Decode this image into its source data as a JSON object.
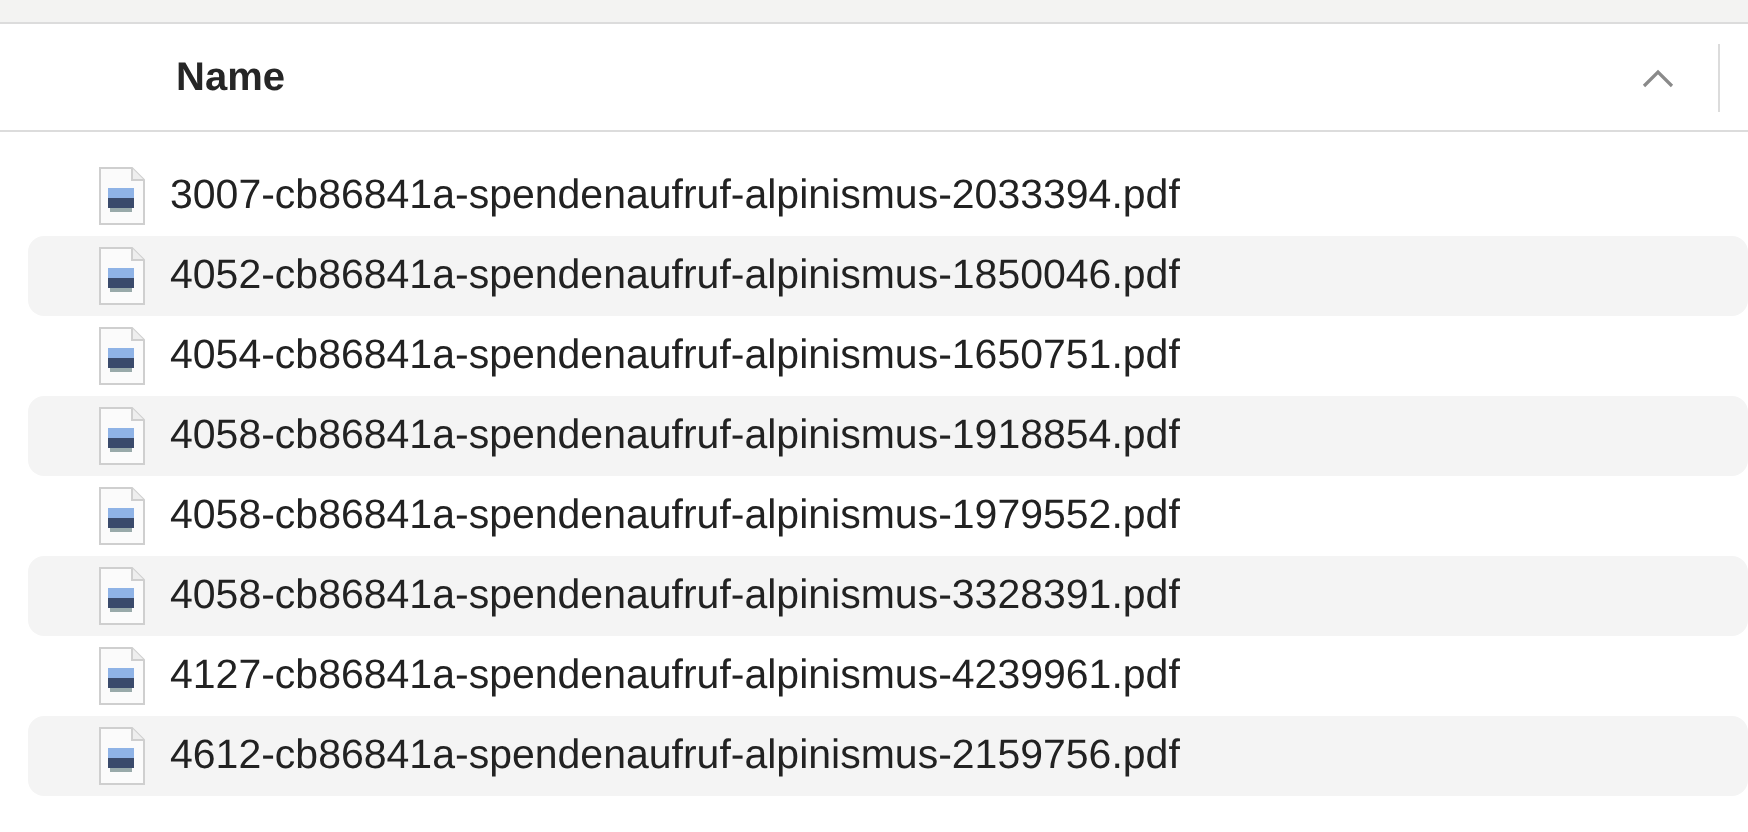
{
  "column": {
    "label": "Name",
    "sort_ascending": true
  },
  "files": [
    {
      "name": "3007-cb86841a-spendenaufruf-alpinismus-2033394.pdf"
    },
    {
      "name": "4052-cb86841a-spendenaufruf-alpinismus-1850046.pdf"
    },
    {
      "name": "4054-cb86841a-spendenaufruf-alpinismus-1650751.pdf"
    },
    {
      "name": "4058-cb86841a-spendenaufruf-alpinismus-1918854.pdf"
    },
    {
      "name": "4058-cb86841a-spendenaufruf-alpinismus-1979552.pdf"
    },
    {
      "name": "4058-cb86841a-spendenaufruf-alpinismus-3328391.pdf"
    },
    {
      "name": "4127-cb86841a-spendenaufruf-alpinismus-4239961.pdf"
    },
    {
      "name": "4612-cb86841a-spendenaufruf-alpinismus-2159756.pdf"
    }
  ]
}
